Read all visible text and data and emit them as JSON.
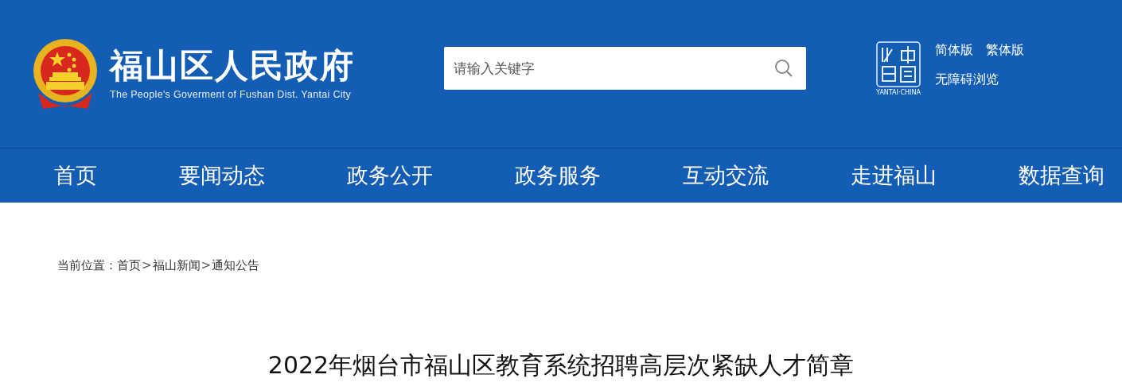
{
  "header": {
    "site_title": "福山区人民政府",
    "site_subtitle": "The People's Goverment of Fushan Dist. Yantai City",
    "search": {
      "placeholder": "请输入关键字"
    },
    "city_logo_caption": "YANTAI·CHINA",
    "links": [
      {
        "label": "简体版"
      },
      {
        "label": "繁体版"
      },
      {
        "label": "无障碍浏览"
      }
    ]
  },
  "nav": [
    {
      "label": "首页"
    },
    {
      "label": "要闻动态"
    },
    {
      "label": "政务公开"
    },
    {
      "label": "政务服务"
    },
    {
      "label": "互动交流"
    },
    {
      "label": "走进福山"
    },
    {
      "label": "数据查询"
    }
  ],
  "breadcrumb": {
    "label": "当前位置：",
    "items": [
      {
        "kind": "link",
        "text": "首页"
      },
      {
        "kind": "separator",
        "text": ">"
      },
      {
        "kind": "link",
        "text": "福山新闻"
      },
      {
        "kind": "separator",
        "text": ">"
      },
      {
        "kind": "link",
        "text": "通知公告"
      }
    ]
  },
  "article": {
    "title": "2022年烟台市福山区教育系统招聘高层次紧缺人才简章"
  }
}
